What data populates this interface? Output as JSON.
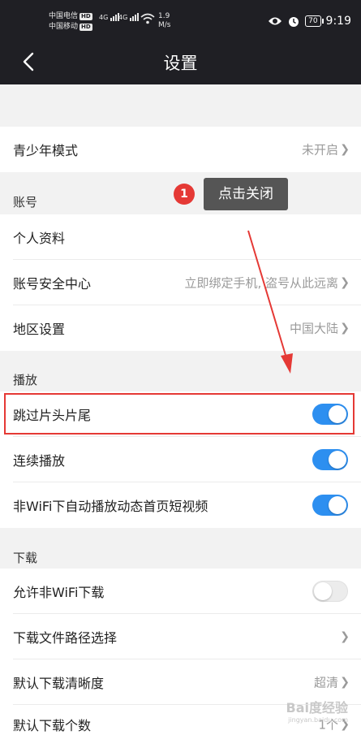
{
  "status_bar": {
    "carrier1": "中国电信",
    "carrier2": "中国移动",
    "hd_label": "HD",
    "net1": "4G",
    "net2": "4G",
    "speed_value": "1.9",
    "speed_unit": "M/s",
    "battery": "70",
    "time": "9:19"
  },
  "header": {
    "title": "设置"
  },
  "teen_mode": {
    "label": "青少年模式",
    "value": "未开启"
  },
  "tooltip": {
    "badge": "1",
    "text": "点击关闭"
  },
  "account": {
    "section_title": "账号",
    "items": [
      {
        "label": "个人资料",
        "value": ""
      },
      {
        "label": "账号安全中心",
        "value": "立即绑定手机, 盗号从此远离"
      },
      {
        "label": "地区设置",
        "value": "中国大陆"
      }
    ]
  },
  "playback": {
    "section_title": "播放",
    "items": [
      {
        "label": "跳过片头片尾",
        "enabled": true
      },
      {
        "label": "连续播放",
        "enabled": true
      },
      {
        "label": "非WiFi下自动播放动态首页短视频",
        "enabled": true
      }
    ]
  },
  "download": {
    "section_title": "下载",
    "items": [
      {
        "label": "允许非WiFi下载",
        "enabled": false
      },
      {
        "label": "下载文件路径选择",
        "value": ""
      },
      {
        "label": "默认下载清晰度",
        "value": "超清"
      },
      {
        "label": "默认下载个数",
        "value": "1个"
      }
    ]
  },
  "watermark": {
    "text": "Bai度经验",
    "url": "jingyan.baidu.com"
  },
  "colors": {
    "accent": "#2d8ff0",
    "highlight": "#e53935",
    "header_bg": "#1f1f24"
  }
}
